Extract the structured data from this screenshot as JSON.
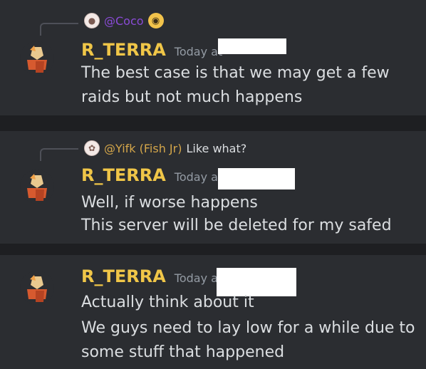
{
  "messages": [
    {
      "reply": {
        "name": "@Coco",
        "text": ""
      },
      "username": "R_TERRA",
      "timestamp": "Today at",
      "lines": [
        "The best case is that we may get a few",
        "raids but not much happens"
      ]
    },
    {
      "reply": {
        "name": "@Yifk (Fish Jr)",
        "text": "Like what?"
      },
      "username": "R_TERRA",
      "timestamp": "Today at",
      "lines": [
        "Well, if worse happens",
        "This server will be deleted for my safed"
      ]
    },
    {
      "username": "R_TERRA",
      "timestamp": "Today at",
      "lines": [
        "Actually think about it",
        "We guys need to lay low for a while due to",
        "some stuff that happened"
      ]
    }
  ],
  "icons": {
    "reply_emoji": "monocle-face-icon",
    "user_avatar": "character-avatar-icon"
  },
  "colors": {
    "background": "#1e1f22",
    "message_bg": "#2b2d31",
    "username": "#f0c648",
    "mention_coco": "#8a4bd6",
    "mention_yifk": "#d4a64a"
  }
}
